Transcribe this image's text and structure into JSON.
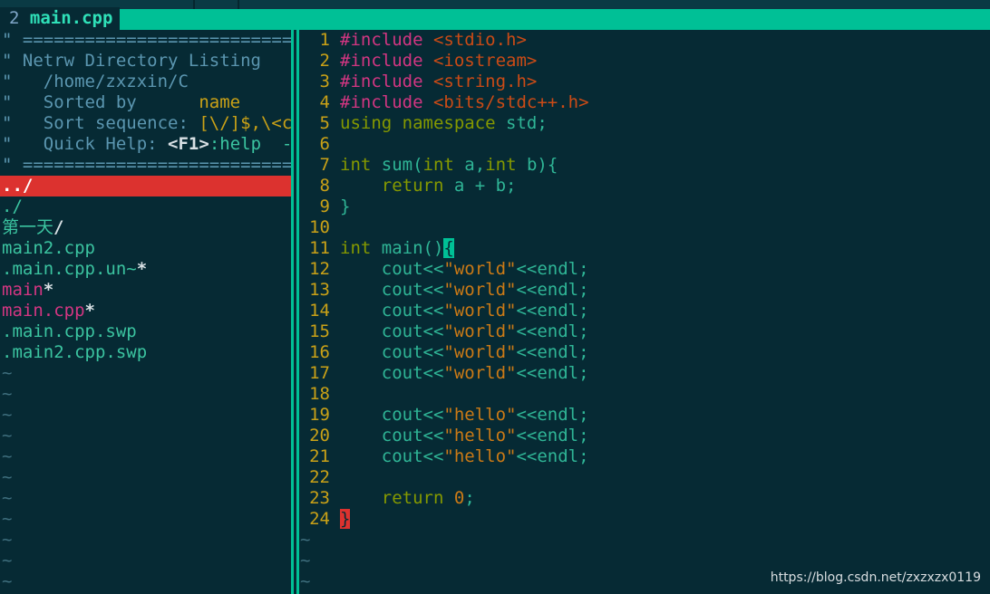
{
  "tabline": {
    "tab_number": "2",
    "tab_title": "main.cpp"
  },
  "netrw": {
    "header": [
      "\" ============================",
      "\" Netrw Directory Listing",
      "\"   /home/zxzxin/C",
      "\"   Sorted by",
      "name",
      "\"   Sort sequence:",
      "[\\/]$,\\<co",
      "\"   Quick Help:",
      "<F1>",
      ":help  -:",
      "\" ============================"
    ],
    "entries": [
      {
        "name": "../",
        "selected": true
      },
      {
        "name": "./",
        "kind": "dir"
      },
      {
        "name": "第一天",
        "suffix": "/",
        "kind": "dir-cn"
      },
      {
        "name": "main2.cpp",
        "kind": "file"
      },
      {
        "name": ".main.cpp.un~",
        "suffix": "*",
        "kind": "file-exec"
      },
      {
        "name": "main",
        "suffix": "*",
        "kind": "exec"
      },
      {
        "name": "main.cpp",
        "suffix": "*",
        "kind": "exec"
      },
      {
        "name": ".main.cpp.swp",
        "kind": "file"
      },
      {
        "name": ".main2.cpp.swp",
        "kind": "file"
      }
    ],
    "tilde": "~"
  },
  "editor": {
    "lines": [
      {
        "n": "1",
        "parts": [
          [
            "pp",
            "#include "
          ],
          [
            "hdr",
            "<stdio.h>"
          ]
        ]
      },
      {
        "n": "2",
        "parts": [
          [
            "pp",
            "#include "
          ],
          [
            "hdr",
            "<iostream>"
          ]
        ]
      },
      {
        "n": "3",
        "parts": [
          [
            "pp",
            "#include "
          ],
          [
            "hdr",
            "<string.h>"
          ]
        ]
      },
      {
        "n": "4",
        "parts": [
          [
            "pp",
            "#include "
          ],
          [
            "hdr",
            "<bits/stdc++.h>"
          ]
        ]
      },
      {
        "n": "5",
        "parts": [
          [
            "kw",
            "using namespace"
          ],
          [
            "code",
            " std;"
          ]
        ]
      },
      {
        "n": "6",
        "parts": []
      },
      {
        "n": "7",
        "parts": [
          [
            "kw",
            "int"
          ],
          [
            "code",
            " sum("
          ],
          [
            "kw",
            "int"
          ],
          [
            "code",
            " a,"
          ],
          [
            "kw",
            "int"
          ],
          [
            "code",
            " b){"
          ]
        ]
      },
      {
        "n": "8",
        "parts": [
          [
            "code",
            "    "
          ],
          [
            "kw",
            "return"
          ],
          [
            "code",
            " a + b;"
          ]
        ]
      },
      {
        "n": "9",
        "parts": [
          [
            "code",
            "}"
          ]
        ]
      },
      {
        "n": "10",
        "parts": []
      },
      {
        "n": "11",
        "parts": [
          [
            "kw",
            "int"
          ],
          [
            "code",
            " main()"
          ],
          [
            "brace-hl",
            "{"
          ]
        ]
      },
      {
        "n": "12",
        "parts": [
          [
            "code",
            "    cout<<"
          ],
          [
            "str",
            "\"world\""
          ],
          [
            "code",
            "<<endl;"
          ]
        ]
      },
      {
        "n": "13",
        "parts": [
          [
            "code",
            "    cout<<"
          ],
          [
            "str",
            "\"world\""
          ],
          [
            "code",
            "<<endl;"
          ]
        ]
      },
      {
        "n": "14",
        "parts": [
          [
            "code",
            "    cout<<"
          ],
          [
            "str",
            "\"world\""
          ],
          [
            "code",
            "<<endl;"
          ]
        ]
      },
      {
        "n": "15",
        "parts": [
          [
            "code",
            "    cout<<"
          ],
          [
            "str",
            "\"world\""
          ],
          [
            "code",
            "<<endl;"
          ]
        ]
      },
      {
        "n": "16",
        "parts": [
          [
            "code",
            "    cout<<"
          ],
          [
            "str",
            "\"world\""
          ],
          [
            "code",
            "<<endl;"
          ]
        ]
      },
      {
        "n": "17",
        "parts": [
          [
            "code",
            "    cout<<"
          ],
          [
            "str",
            "\"world\""
          ],
          [
            "code",
            "<<endl;"
          ]
        ]
      },
      {
        "n": "18",
        "parts": []
      },
      {
        "n": "19",
        "parts": [
          [
            "code",
            "    cout<<"
          ],
          [
            "str",
            "\"hello\""
          ],
          [
            "code",
            "<<endl;"
          ]
        ]
      },
      {
        "n": "20",
        "parts": [
          [
            "code",
            "    cout<<"
          ],
          [
            "str",
            "\"hello\""
          ],
          [
            "code",
            "<<endl;"
          ]
        ]
      },
      {
        "n": "21",
        "parts": [
          [
            "code",
            "    cout<<"
          ],
          [
            "str",
            "\"hello\""
          ],
          [
            "code",
            "<<endl;"
          ]
        ]
      },
      {
        "n": "22",
        "parts": []
      },
      {
        "n": "23",
        "parts": [
          [
            "code",
            "    "
          ],
          [
            "kw",
            "return"
          ],
          [
            "code",
            " "
          ],
          [
            "num-lit",
            "0"
          ],
          [
            "code",
            ";"
          ]
        ]
      },
      {
        "n": "24",
        "parts": [
          [
            "brace-red",
            "}"
          ]
        ]
      }
    ],
    "tilde": "~"
  },
  "watermark": "https://blog.csdn.net/zxzxzx0119",
  "colors": {
    "background": "#062a34",
    "tabline_accent": "#00c096",
    "selection": "#dc322f",
    "line_number": "#c9a117"
  }
}
